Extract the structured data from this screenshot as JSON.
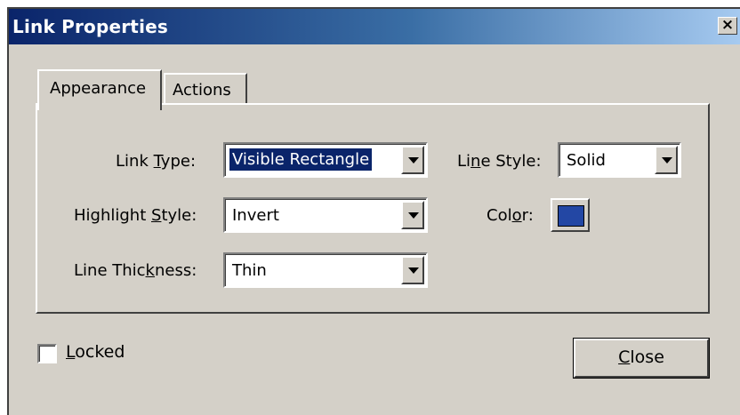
{
  "window": {
    "title": "Link Properties",
    "close_glyph": "×"
  },
  "tabs": [
    {
      "label": "Appearance",
      "active": true
    },
    {
      "label": "Actions",
      "active": false
    }
  ],
  "fields": {
    "link_type": {
      "label_pre": "Link ",
      "label_key": "T",
      "label_post": "ype:",
      "value": "Visible Rectangle"
    },
    "highlight_style": {
      "label_pre": "Highlight ",
      "label_key": "S",
      "label_post": "tyle:",
      "value": "Invert"
    },
    "line_thickness": {
      "label_pre": "Line Thic",
      "label_key": "k",
      "label_post": "ness:",
      "value": "Thin"
    },
    "line_style": {
      "label_pre": "Li",
      "label_key": "n",
      "label_post": "e Style:",
      "value": "Solid"
    },
    "color": {
      "label_pre": "Col",
      "label_key": "o",
      "label_post": "r:",
      "value": "#2347a4"
    }
  },
  "locked": {
    "label_key": "L",
    "label_rest": "ocked",
    "checked": false
  },
  "close_button": {
    "label_key": "C",
    "label_rest": "lose"
  },
  "icons": {
    "dropdown": "chevron-down-icon",
    "close": "close-icon"
  }
}
